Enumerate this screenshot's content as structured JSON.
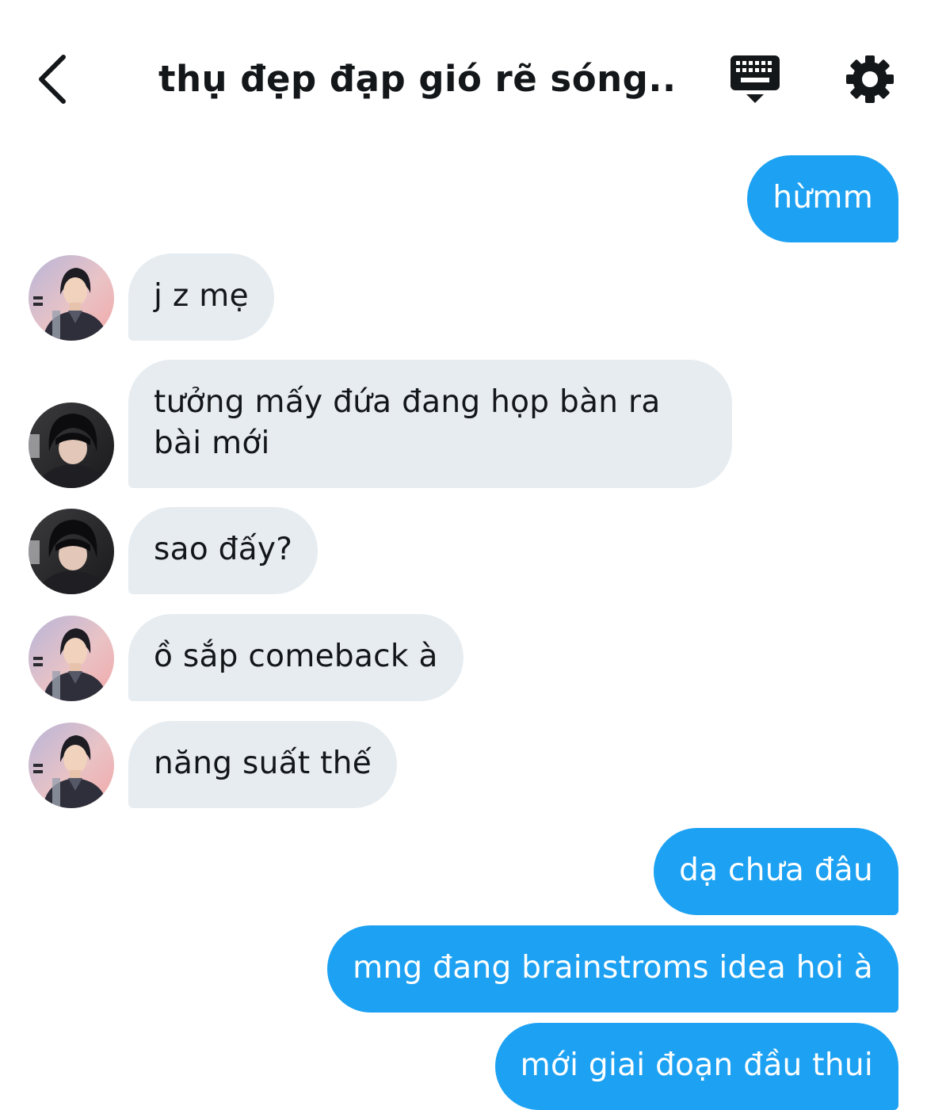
{
  "header": {
    "title": "thụ đẹp đạp gió rẽ sóng...",
    "back_icon": "chevron-left-icon",
    "keyboard_icon": "keyboard-icon",
    "settings_icon": "gear-icon"
  },
  "colors": {
    "outgoing_bubble": "#1da1f2",
    "incoming_bubble": "#e6ecf0",
    "text_dark": "#14171a"
  },
  "messages": [
    {
      "direction": "out",
      "text": "hừmm"
    },
    {
      "direction": "in",
      "sender": "member-a",
      "text": "j z mẹ"
    },
    {
      "direction": "in",
      "sender": "member-b",
      "text": "tưởng mấy đứa đang họp bàn ra bài mới"
    },
    {
      "direction": "in",
      "sender": "member-b",
      "text": "sao đấy?"
    },
    {
      "direction": "in",
      "sender": "member-a",
      "text": "ồ sắp comeback à"
    },
    {
      "direction": "in",
      "sender": "member-a",
      "text": "năng suất thế"
    },
    {
      "direction": "out",
      "text": "dạ chưa đâu"
    },
    {
      "direction": "out",
      "text": "mng đang brainstroms idea hoi à"
    },
    {
      "direction": "out",
      "text": "mới giai đoạn đầu thui"
    }
  ]
}
